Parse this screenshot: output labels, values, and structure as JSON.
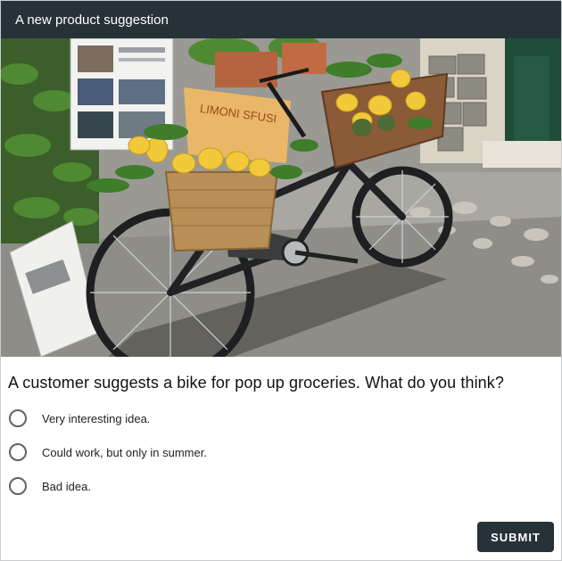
{
  "dialog": {
    "title": "A new product suggestion"
  },
  "photo": {
    "subject": "bicycle-with-lemon-baskets",
    "sign_text": "LIMONI SFUSI"
  },
  "survey": {
    "question": "A customer suggests a bike for pop up groceries. What do you think?",
    "options": [
      {
        "label": "Very interesting idea.",
        "selected": false
      },
      {
        "label": "Could work, but only in summer.",
        "selected": false
      },
      {
        "label": "Bad idea.",
        "selected": false
      }
    ],
    "submit_label": "SUBMIT"
  },
  "colors": {
    "header_bg": "#263238",
    "header_text": "#ffffff",
    "button_bg": "#263238",
    "radio_border": "#5f6368"
  }
}
